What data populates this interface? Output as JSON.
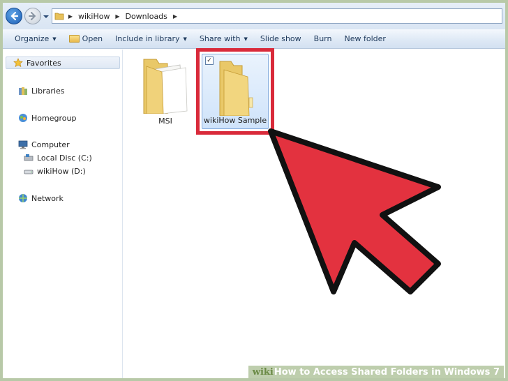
{
  "address_bar": {
    "breadcrumbs": [
      "wikiHow",
      "Downloads"
    ]
  },
  "toolbar": {
    "organize": "Organize",
    "open": "Open",
    "include_in_library": "Include in library",
    "share_with": "Share with",
    "slide_show": "Slide show",
    "burn": "Burn",
    "new_folder": "New folder"
  },
  "nav_pane": {
    "favorites": "Favorites",
    "libraries": "Libraries",
    "homegroup": "Homegroup",
    "computer": "Computer",
    "local_disc": "Local Disc (C:)",
    "wikihow_drive": "wikiHow (D:)",
    "network": "Network"
  },
  "content": {
    "folders": [
      {
        "name": "MSI",
        "selected": false
      },
      {
        "name": "wikiHow Sample",
        "selected": true
      }
    ]
  },
  "annotation": {
    "highlight_color": "#d92a3a",
    "arrow_color": "#e3323f"
  },
  "watermark": {
    "brand": "wiki",
    "how": "How",
    "title": " to Access Shared Folders in Windows 7"
  }
}
